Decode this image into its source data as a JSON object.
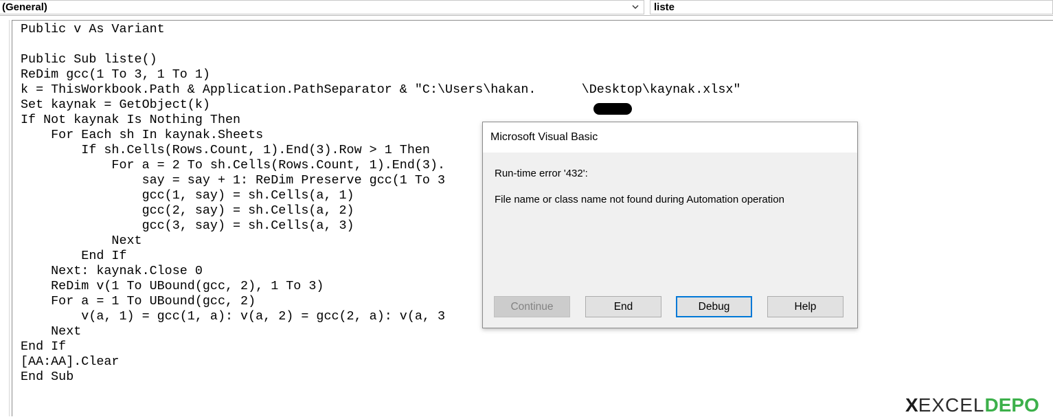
{
  "topbar": {
    "object_combo": "(General)",
    "procedure_combo": "liste"
  },
  "code": {
    "lines": [
      "Public v As Variant",
      "",
      "Public Sub liste()",
      "ReDim gcc(1 To 3, 1 To 1)",
      "k = ThisWorkbook.Path & Application.PathSeparator & \"C:\\Users\\hakan.      \\Desktop\\kaynak.xlsx\"",
      "Set kaynak = GetObject(k)",
      "If Not kaynak Is Nothing Then",
      "    For Each sh In kaynak.Sheets",
      "        If sh.Cells(Rows.Count, 1).End(3).Row > 1 Then",
      "            For a = 2 To sh.Cells(Rows.Count, 1).End(3).",
      "                say = say + 1: ReDim Preserve gcc(1 To 3",
      "                gcc(1, say) = sh.Cells(a, 1)",
      "                gcc(2, say) = sh.Cells(a, 2)",
      "                gcc(3, say) = sh.Cells(a, 3)",
      "            Next",
      "        End If",
      "    Next: kaynak.Close 0",
      "    ReDim v(1 To UBound(gcc, 2), 1 To 3)",
      "    For a = 1 To UBound(gcc, 2)",
      "        v(a, 1) = gcc(1, a): v(a, 2) = gcc(2, a): v(a, 3",
      "    Next",
      "End If",
      "[AA:AA].Clear",
      "End Sub"
    ]
  },
  "dialog": {
    "title": "Microsoft Visual Basic",
    "error_line": "Run-time error '432':",
    "message": "File name or class name not found during Automation operation",
    "buttons": {
      "continue": "Continue",
      "end": "End",
      "debug": "Debug",
      "help": "Help"
    }
  },
  "watermark": {
    "x": "X",
    "excel": "EXCEL",
    "demo": "DEPO"
  },
  "colors": {
    "default_button_border": "#0078d7",
    "watermark_green": "#3cb04a"
  }
}
